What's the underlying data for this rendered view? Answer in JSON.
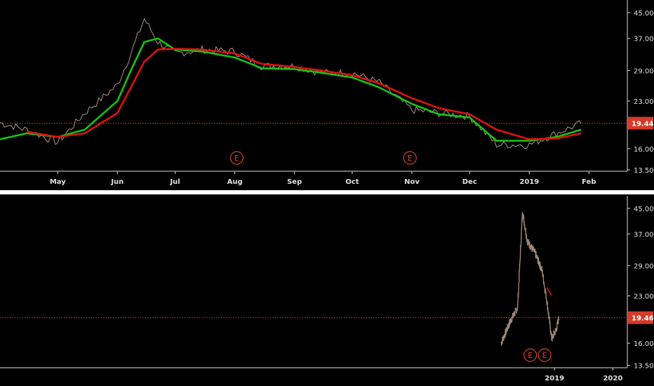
{
  "colors": {
    "background": "#000000",
    "axis_text": "#e0e0e0",
    "axis_line": "#dcdcdc",
    "price": "#a08878",
    "ema_fast": "#16c316",
    "ema_slow": "#e01010",
    "last_price": "#d63a2a",
    "earnings": "#d9412e",
    "separator": "#ffffff"
  },
  "earnings_marker": "E",
  "chart_data": [
    {
      "type": "line",
      "title": "",
      "scale": "log",
      "ylim": [
        13.5,
        48
      ],
      "y_ticks": [
        "45.00",
        "37.00",
        "29.00",
        "23.00",
        "16.00",
        "13.50"
      ],
      "x_ticks": [
        "May",
        "Jun",
        "Jul",
        "Aug",
        "Sep",
        "Oct",
        "Nov",
        "Dec",
        "2019",
        "Feb"
      ],
      "last_price_label": "19.44",
      "last_price": 19.44,
      "earnings_dates": [
        "2018-08-02",
        "2018-10-31"
      ],
      "x": [
        "2018-04-01",
        "2018-04-15",
        "2018-05-01",
        "2018-05-15",
        "2018-06-01",
        "2018-06-08",
        "2018-06-15",
        "2018-06-22",
        "2018-07-01",
        "2018-07-15",
        "2018-08-01",
        "2018-08-15",
        "2018-09-01",
        "2018-09-15",
        "2018-10-01",
        "2018-10-15",
        "2018-11-01",
        "2018-11-15",
        "2018-12-01",
        "2018-12-15",
        "2019-01-01",
        "2019-01-15",
        "2019-01-28"
      ],
      "series": [
        {
          "values": [
            19.5,
            18.5,
            16.8,
            21.0,
            26.0,
            33.0,
            43.0,
            36.0,
            33.0,
            34.0,
            33.5,
            30.0,
            30.0,
            28.5,
            28.5,
            26.5,
            21.5,
            21.0,
            20.5,
            16.5,
            16.5,
            18.0,
            19.44
          ]
        },
        {
          "values": [
            17.2,
            18.0,
            17.5,
            18.5,
            23.0,
            29.0,
            36.0,
            37.0,
            34.0,
            33.5,
            32.0,
            29.5,
            29.3,
            28.5,
            27.5,
            25.5,
            22.5,
            20.8,
            20.3,
            17.0,
            17.0,
            17.5,
            18.5
          ]
        },
        {
          "values": [
            null,
            18.2,
            17.5,
            18.0,
            21.0,
            25.5,
            31.0,
            34.0,
            34.2,
            34.0,
            33.0,
            30.5,
            29.8,
            29.0,
            28.0,
            26.3,
            23.5,
            21.8,
            20.8,
            18.5,
            17.2,
            17.3,
            18.0
          ]
        }
      ]
    },
    {
      "type": "line",
      "title": "",
      "scale": "log",
      "ylim": [
        13.5,
        48
      ],
      "y_ticks": [
        "45.00",
        "37.00",
        "29.00",
        "23.00",
        "16.00",
        "13.50"
      ],
      "x_ticks": [
        "2019",
        "2020"
      ],
      "last_price_label": "19.46",
      "last_price": 19.46,
      "earnings_dates": [
        "2018-08-02",
        "2018-10-31"
      ],
      "x": [
        "2018-02-01",
        "2018-04-01",
        "2018-05-15",
        "2018-06-15",
        "2018-07-15",
        "2018-09-01",
        "2018-10-15",
        "2018-11-15",
        "2018-12-15",
        "2019-01-15",
        "2019-01-28"
      ],
      "series": [
        {
          "values": [
            16.0,
            19.0,
            21.0,
            44.0,
            35.0,
            32.0,
            28.0,
            22.0,
            16.5,
            18.0,
            19.46
          ]
        },
        {
          "values": [
            null,
            null,
            null,
            null,
            null,
            null,
            null,
            24.5,
            23.0,
            null,
            null
          ]
        }
      ]
    }
  ]
}
